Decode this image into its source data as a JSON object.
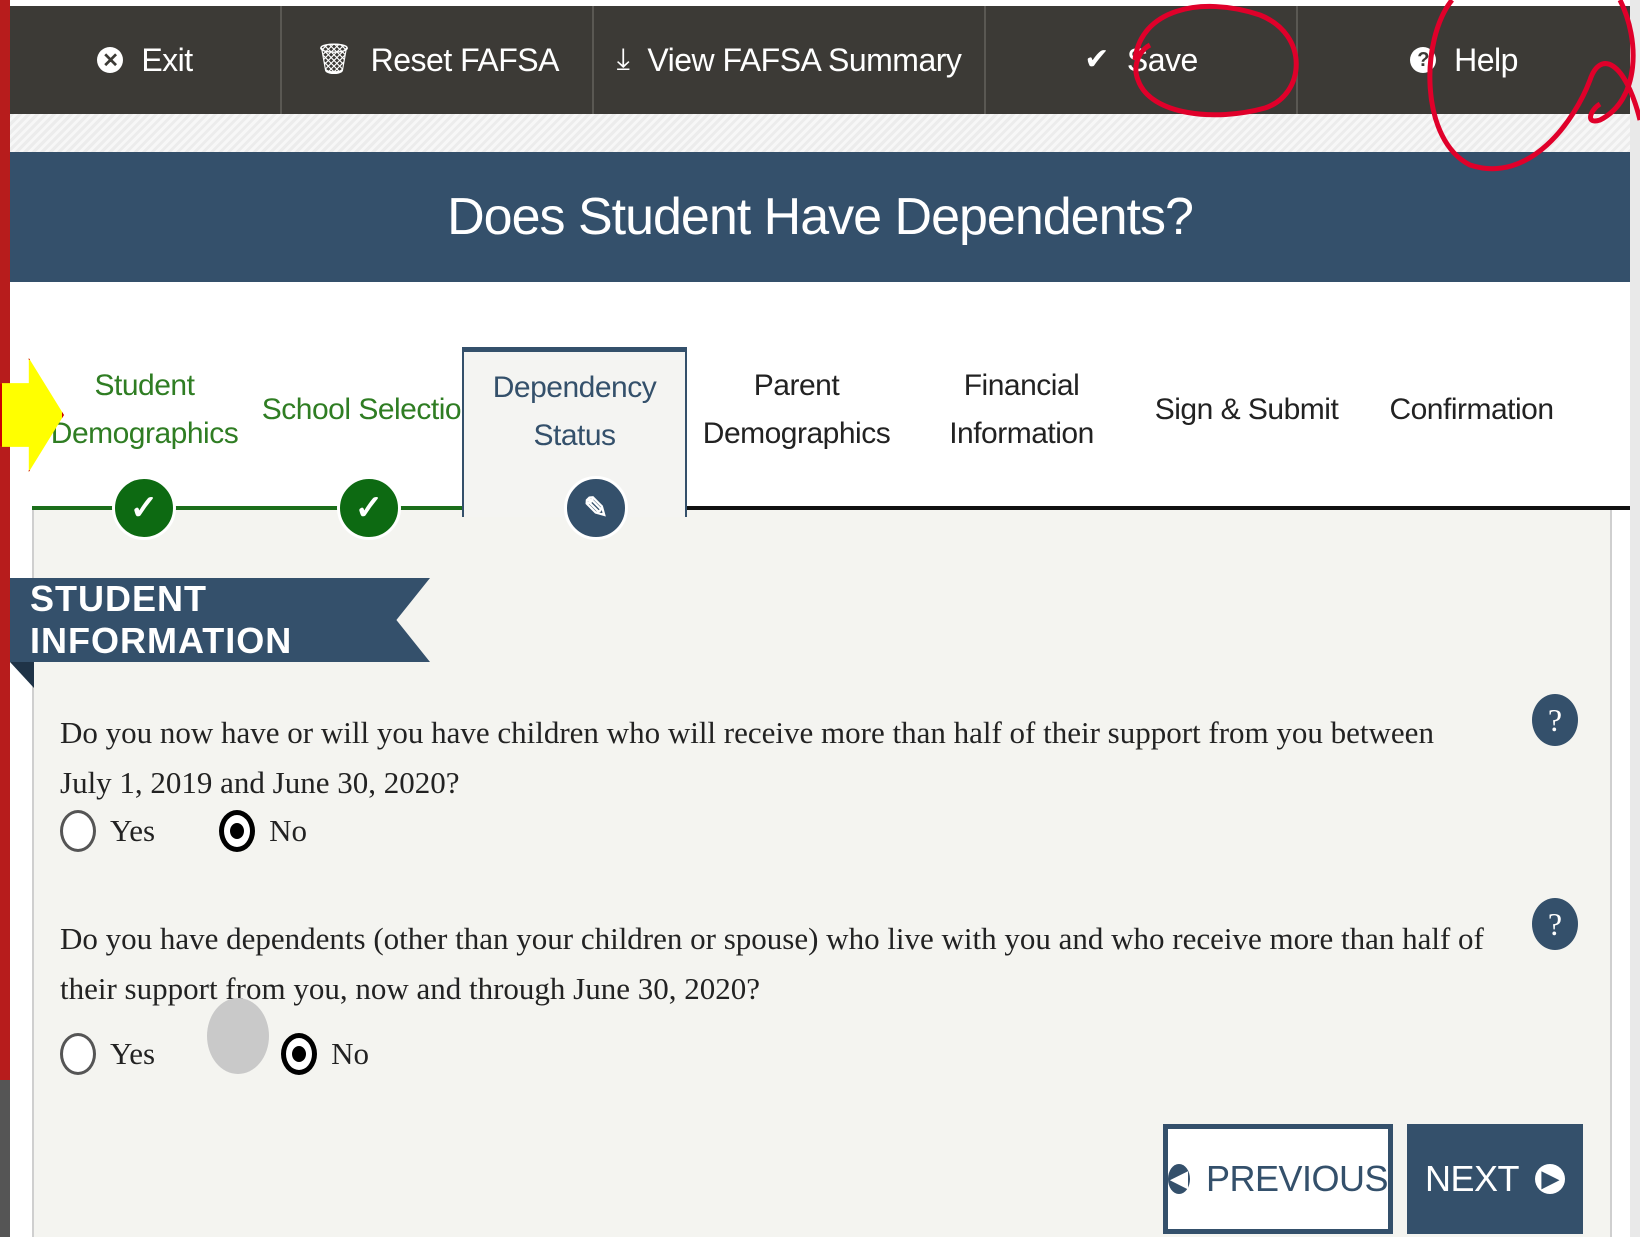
{
  "toolbar": {
    "items": [
      {
        "label": "Exit",
        "icon": "exit-icon"
      },
      {
        "label": "Reset FAFSA",
        "icon": "trash-icon"
      },
      {
        "label": "View FAFSA Summary",
        "icon": "download-icon"
      },
      {
        "label": "Save",
        "icon": "checkmark-icon"
      },
      {
        "label": "Help",
        "icon": "help-icon"
      }
    ]
  },
  "page_title": "Does Student Have Dependents?",
  "steps": [
    {
      "label": "Student Demographics",
      "status": "complete"
    },
    {
      "label": "School Selection",
      "status": "complete"
    },
    {
      "label": "Dependency Status",
      "status": "active"
    },
    {
      "label": "Parent Demographics",
      "status": "incomplete"
    },
    {
      "label": "Financial Information",
      "status": "incomplete"
    },
    {
      "label": "Sign & Submit",
      "status": "incomplete"
    },
    {
      "label": "Confirmation",
      "status": "incomplete"
    }
  ],
  "section_title": "STUDENT INFORMATION",
  "questions": [
    {
      "text": "Do you now have or will you have children who will receive more than half of their support from you between July 1, 2019 and June 30, 2020?",
      "options": [
        "Yes",
        "No"
      ],
      "selected": "No"
    },
    {
      "text": "Do you have dependents (other than your children or spouse) who live with you and who receive more than half of their support from you, now and through June 30, 2020?",
      "options": [
        "Yes",
        "No"
      ],
      "selected": "No"
    }
  ],
  "help_icon_label": "?",
  "buttons": {
    "previous": "PREVIOUS",
    "next": "NEXT"
  },
  "colors": {
    "toolbar": "#3c3a36",
    "primary": "#34506b",
    "complete": "#0d6a12",
    "annotation": "#e0002a"
  }
}
